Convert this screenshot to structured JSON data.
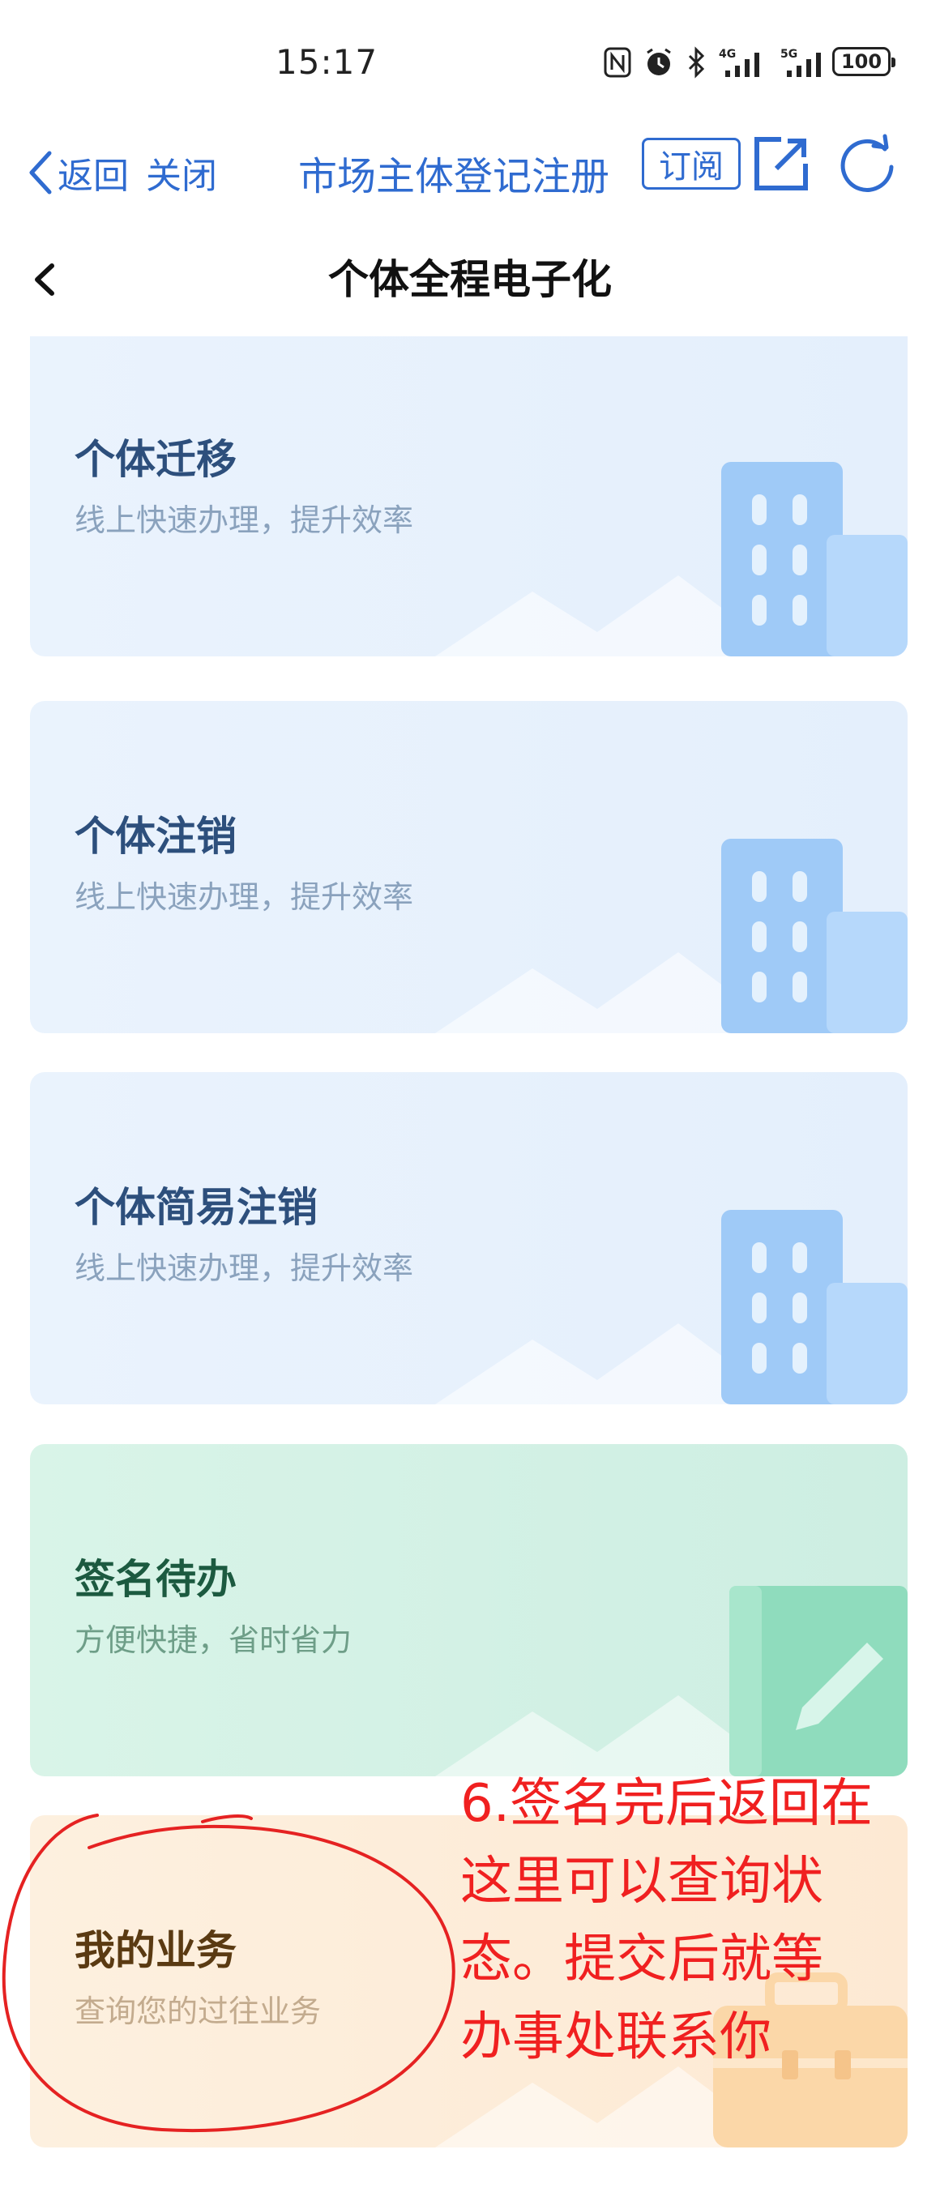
{
  "status_bar": {
    "time": "15:17",
    "battery": "100",
    "network_1": "4G",
    "network_2": "5G",
    "icons": [
      "nfc-icon",
      "alarm-icon",
      "bluetooth-icon",
      "signal-4g-icon",
      "signal-5g-icon",
      "battery-icon"
    ]
  },
  "top_nav": {
    "back_label": "返回",
    "close_label": "关闭",
    "title": "市场主体登记注册",
    "subscribe_label": "订阅",
    "accent_color": "#2f6bd0"
  },
  "page_header": {
    "title": "个体全程电子化"
  },
  "cards": [
    {
      "title": "个体迁移",
      "subtitle": "线上快速办理，提升效率",
      "theme": "blue",
      "icon": "building-icon"
    },
    {
      "title": "个体注销",
      "subtitle": "线上快速办理，提升效率",
      "theme": "blue",
      "icon": "building-icon"
    },
    {
      "title": "个体简易注销",
      "subtitle": "线上快速办理，提升效率",
      "theme": "blue",
      "icon": "building-icon"
    },
    {
      "title": "签名待办",
      "subtitle": "方便快捷，省时省力",
      "theme": "green",
      "icon": "notebook-pen-icon"
    },
    {
      "title": "我的业务",
      "subtitle": "查询您的过往业务",
      "theme": "orange",
      "icon": "briefcase-icon"
    }
  ],
  "annotation": {
    "lines": [
      "6.签名完后返回在",
      "这里可以查询状",
      "态。提交后就等",
      "办事处联系你"
    ],
    "color": "#f02020"
  }
}
